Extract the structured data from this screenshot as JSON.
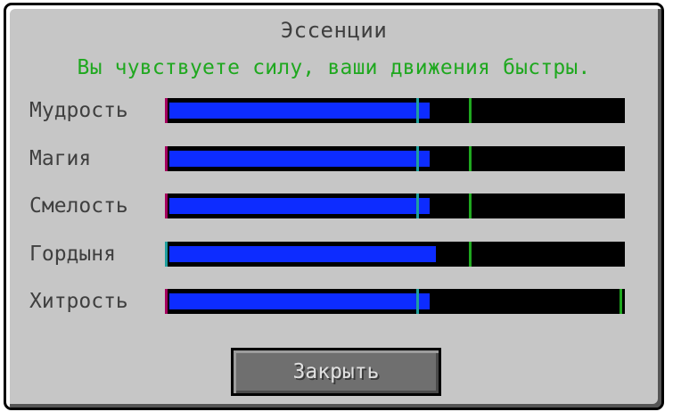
{
  "title": "Эссенции",
  "status": "Вы чувствуете силу, ваши движения быстры.",
  "colors": {
    "fill": "#0d2cff",
    "marker_purple": "#a4005e",
    "marker_teal": "#1f9f9f",
    "marker_green": "#1fa81f",
    "status_text": "#1fa81f"
  },
  "essences": [
    {
      "label": "Мудрость",
      "value": 0.58,
      "markers": [
        {
          "pos": 0.0,
          "color": "#a4005e"
        },
        {
          "pos": 0.55,
          "color": "#1f9f9f"
        },
        {
          "pos": 0.665,
          "color": "#1fa81f"
        }
      ]
    },
    {
      "label": "Магия",
      "value": 0.58,
      "markers": [
        {
          "pos": 0.0,
          "color": "#a4005e"
        },
        {
          "pos": 0.55,
          "color": "#1f9f9f"
        },
        {
          "pos": 0.665,
          "color": "#1fa81f"
        }
      ]
    },
    {
      "label": "Смелость",
      "value": 0.58,
      "markers": [
        {
          "pos": 0.0,
          "color": "#a4005e"
        },
        {
          "pos": 0.55,
          "color": "#1f9f9f"
        },
        {
          "pos": 0.665,
          "color": "#1fa81f"
        }
      ]
    },
    {
      "label": "Гордыня",
      "value": 0.595,
      "markers": [
        {
          "pos": 0.0,
          "color": "#1f9f9f"
        },
        {
          "pos": 0.665,
          "color": "#1fa81f"
        }
      ]
    },
    {
      "label": "Хитрость",
      "value": 0.58,
      "markers": [
        {
          "pos": 0.0,
          "color": "#a4005e"
        },
        {
          "pos": 0.55,
          "color": "#1f9f9f"
        },
        {
          "pos": 0.995,
          "color": "#1fa81f"
        }
      ]
    }
  ],
  "close_button": {
    "label": "Закрыть"
  }
}
